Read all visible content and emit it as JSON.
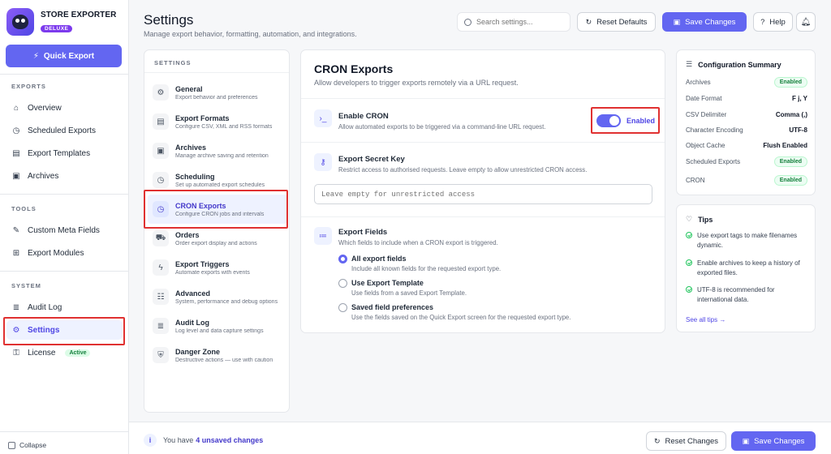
{
  "brand": {
    "name": "STORE EXPORTER",
    "badge": "DELUXE"
  },
  "quick_export": {
    "label": "Quick Export",
    "icon": "bolt-icon"
  },
  "sidebar": {
    "sections": [
      {
        "label": "EXPORTS",
        "items": [
          "Overview",
          "Scheduled Exports",
          "Export Templates",
          "Archives"
        ]
      },
      {
        "label": "TOOLS",
        "items": [
          "Custom Meta Fields",
          "Export Modules"
        ]
      },
      {
        "label": "SYSTEM",
        "items": [
          "Audit Log",
          "Settings",
          "License"
        ]
      }
    ],
    "license_badge": "Active",
    "active_item": "Settings",
    "collapse": "Collapse"
  },
  "header": {
    "title": "Settings",
    "subtitle": "Manage export behavior, formatting, automation, and integrations.",
    "search_placeholder": "Search settings...",
    "reset_defaults": "Reset Defaults",
    "save_changes": "Save Changes",
    "help": "Help"
  },
  "settings_list": {
    "label": "SETTINGS",
    "items": [
      {
        "title": "General",
        "desc": "Export behavior and preferences"
      },
      {
        "title": "Export Formats",
        "desc": "Configure CSV, XML and RSS formats"
      },
      {
        "title": "Archives",
        "desc": "Manage archive saving and retention"
      },
      {
        "title": "Scheduling",
        "desc": "Set up automated export schedules"
      },
      {
        "title": "CRON Exports",
        "desc": "Configure CRON jobs and intervals"
      },
      {
        "title": "Orders",
        "desc": "Order export display and actions"
      },
      {
        "title": "Export Triggers",
        "desc": "Automate exports with events"
      },
      {
        "title": "Advanced",
        "desc": "System, performance and debug options"
      },
      {
        "title": "Audit Log",
        "desc": "Log level and data capture settings"
      },
      {
        "title": "Danger Zone",
        "desc": "Destructive actions — use with caution"
      }
    ],
    "active": "CRON Exports"
  },
  "cron": {
    "title": "CRON Exports",
    "subtitle": "Allow developers to trigger exports remotely via a URL request.",
    "enable": {
      "title": "Enable CRON",
      "desc": "Allow automated exports to be triggered via a command-line URL request.",
      "toggle_label": "Enabled",
      "on": true
    },
    "secret": {
      "title": "Export Secret Key",
      "desc": "Restrict access to authorised requests. Leave empty to allow unrestricted CRON access.",
      "placeholder": "Leave empty for unrestricted access",
      "value": ""
    },
    "fields": {
      "title": "Export Fields",
      "desc": "Which fields to include when a CRON export is triggered.",
      "options": [
        {
          "label": "All export fields",
          "desc": "Include all known fields for the requested export type.",
          "checked": true
        },
        {
          "label": "Use Export Template",
          "desc": "Use fields from a saved Export Template.",
          "checked": false
        },
        {
          "label": "Saved field preferences",
          "desc": "Use the fields saved on the Quick Export screen for the requested export type.",
          "checked": false
        }
      ]
    }
  },
  "summary": {
    "title": "Configuration Summary",
    "rows": [
      {
        "key": "Archives",
        "value": "Enabled",
        "badge": true
      },
      {
        "key": "Date Format",
        "value": "F j, Y",
        "badge": false
      },
      {
        "key": "CSV Delimiter",
        "value": "Comma (,)",
        "badge": false
      },
      {
        "key": "Character Encoding",
        "value": "UTF-8",
        "badge": false
      },
      {
        "key": "Object Cache",
        "value": "Flush Enabled",
        "badge": false
      },
      {
        "key": "Scheduled Exports",
        "value": "Enabled",
        "badge": true
      },
      {
        "key": "CRON",
        "value": "Enabled",
        "badge": true
      }
    ]
  },
  "tips": {
    "title": "Tips",
    "items": [
      "Use export tags to make filenames dynamic.",
      "Enable archives to keep a history of exported files.",
      "UTF-8 is recommended for international data."
    ],
    "see_all": "See all tips →"
  },
  "bottom": {
    "prefix": "You have",
    "count": "4 unsaved changes",
    "reset": "Reset Changes",
    "save": "Save Changes"
  },
  "colors": {
    "accent": "#6366f1",
    "highlight": "#e03131",
    "success": "#15803d"
  }
}
